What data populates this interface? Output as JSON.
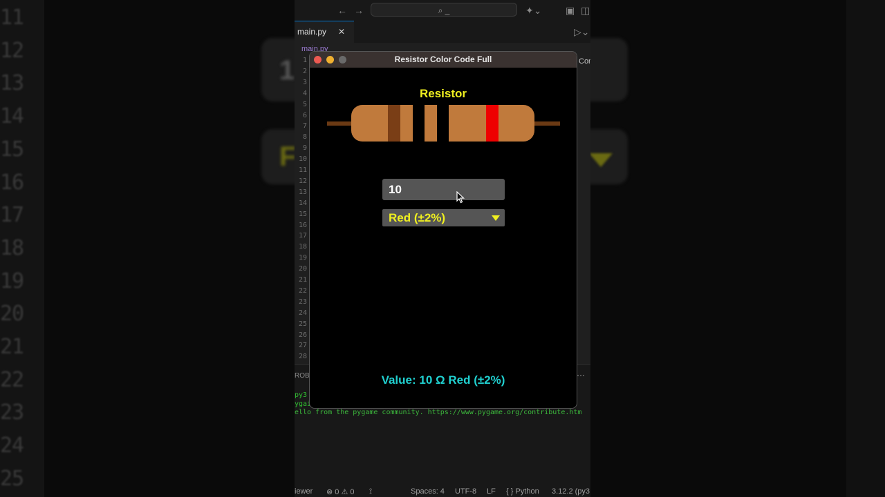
{
  "background": {
    "line_numbers": [
      "11",
      "12",
      "13",
      "14",
      "15",
      "16",
      "17",
      "18",
      "19",
      "20",
      "21",
      "22",
      "23",
      "24",
      "25"
    ]
  },
  "vscode": {
    "command_center": "⌕ _",
    "tab_label": "main.py",
    "breadcrumb": "main.py",
    "editor_line_numbers": [
      "1",
      "2",
      "3",
      "4",
      "5",
      "6",
      "7",
      "8",
      "9",
      "10",
      "11",
      "12",
      "13",
      "14",
      "15",
      "16",
      "17",
      "18",
      "19",
      "20",
      "21",
      "22",
      "23",
      "24",
      "25",
      "26",
      "27",
      "28"
    ],
    "right_peek": "Com",
    "panel_tab": "ROB",
    "terminal_lines": [
      "py3",
      "ygai",
      "ello from the pygame community. https://www.pygame.org/contribute.htm"
    ],
    "statusbar": {
      "left": "iewer",
      "problems": "⊗ 0 ⚠ 0",
      "spaces": "Spaces: 4",
      "encoding": "UTF-8",
      "eol": "LF",
      "language": "{ } Python",
      "version": "3.12.2 (py3"
    }
  },
  "app": {
    "window_title": "Resistor Color Code Full",
    "heading": "Resistor",
    "resistance_input": "10",
    "tolerance_select": "Red (±2%)",
    "result": "Value: 10 Ω  Red (±2%)",
    "colors": {
      "heading": "#f0f020",
      "result": "#20d0d0",
      "resistor_body": "#c07a3c",
      "lead": "#6b3a14",
      "band_brown": "#7a3e16",
      "band_red": "#ee0000"
    }
  }
}
